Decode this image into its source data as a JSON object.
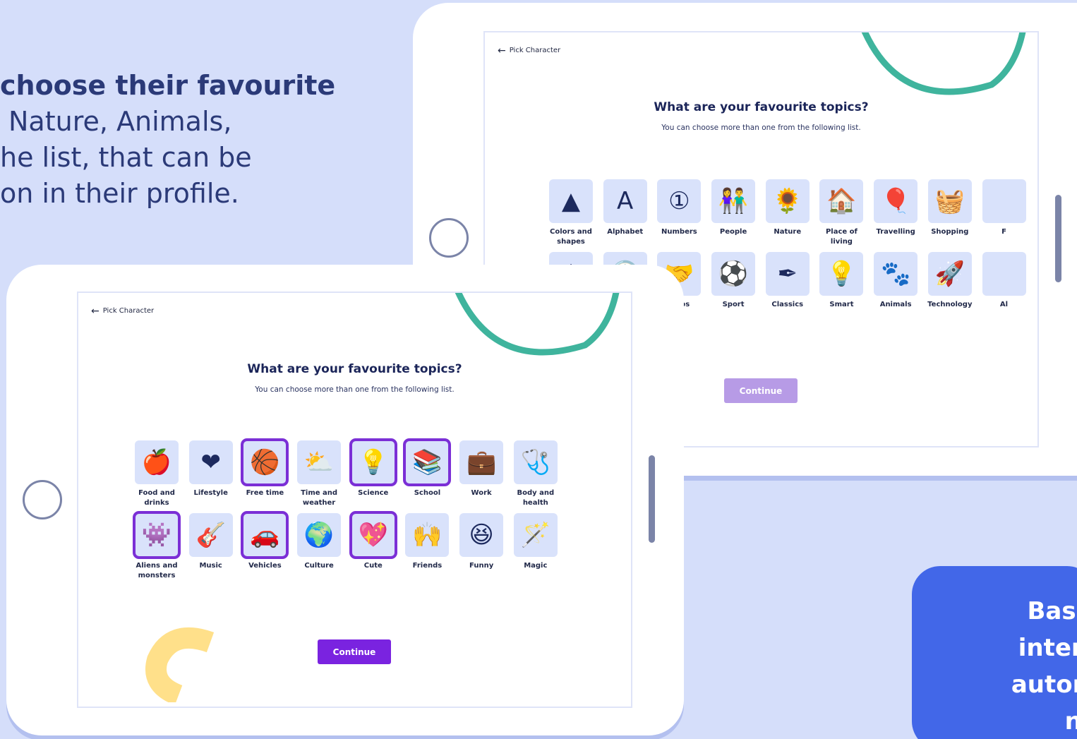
{
  "intro": {
    "line1": "choose their favourite",
    "line2": "Nature, Animals,",
    "line3": "he list, that can be",
    "line4": "on in their profile."
  },
  "banner": {
    "line1": "Based",
    "line2": "interes",
    "line3": "automa",
    "line4": "nev"
  },
  "colors": {
    "accent": "#7a23e0",
    "tile_bg": "#d9e2fb",
    "arc_green": "#3fb49d",
    "arc_yellow": "#ffe08a",
    "banner": "#4267e8"
  },
  "back_screen": {
    "back_label": "Pick Character",
    "title": "What are your favourite topics?",
    "subtitle": "You can choose more than one from the following list.",
    "continue": "Continue",
    "row1": [
      {
        "label": "Colors and shapes",
        "icon": "shapes-icon",
        "glyph": "▲"
      },
      {
        "label": "Alphabet",
        "icon": "alphabet-blocks-icon",
        "glyph": "A"
      },
      {
        "label": "Numbers",
        "icon": "numbers-icon",
        "glyph": "①"
      },
      {
        "label": "People",
        "icon": "people-icon",
        "glyph": "👫"
      },
      {
        "label": "Nature",
        "icon": "flower-icon",
        "glyph": "🌻"
      },
      {
        "label": "Place of living",
        "icon": "house-icon",
        "glyph": "🏠"
      },
      {
        "label": "Travelling",
        "icon": "balloon-icon",
        "glyph": "🎈"
      },
      {
        "label": "Shopping",
        "icon": "basket-icon",
        "glyph": "🧺"
      },
      {
        "label": "F",
        "icon": "partial-icon",
        "glyph": ""
      }
    ],
    "row2": [
      {
        "label": "",
        "icon": "weather-partial-icon",
        "glyph": "☀"
      },
      {
        "label": "",
        "icon": "clock-partial-icon",
        "glyph": "🕒"
      },
      {
        "label": "ships",
        "icon": "handshake-icon",
        "glyph": "🤝"
      },
      {
        "label": "Sport",
        "icon": "sport-balls-icon",
        "glyph": "⚽"
      },
      {
        "label": "Classics",
        "icon": "quill-icon",
        "glyph": "✒"
      },
      {
        "label": "Smart",
        "icon": "lightbulb-icon",
        "glyph": "💡"
      },
      {
        "label": "Animals",
        "icon": "pawprint-icon",
        "glyph": "🐾"
      },
      {
        "label": "Technology",
        "icon": "rocket-icon",
        "glyph": "🚀"
      },
      {
        "label": "Al",
        "icon": "partial-icon",
        "glyph": ""
      }
    ]
  },
  "front_screen": {
    "back_label": "Pick Character",
    "title": "What are your favourite topics?",
    "subtitle": "You can choose more than one from the following list.",
    "continue": "Continue",
    "row1": [
      {
        "label": "Food and drinks",
        "icon": "food-drinks-icon",
        "glyph": "🍎",
        "selected": false
      },
      {
        "label": "Lifestyle",
        "icon": "heart-icon",
        "glyph": "❤",
        "selected": false
      },
      {
        "label": "Free time",
        "icon": "basketball-icon",
        "glyph": "🏀",
        "selected": true
      },
      {
        "label": "Time and weather",
        "icon": "cloud-clock-icon",
        "glyph": "⛅",
        "selected": false
      },
      {
        "label": "Science",
        "icon": "lightbulb-icon",
        "glyph": "💡",
        "selected": true
      },
      {
        "label": "School",
        "icon": "books-apple-icon",
        "glyph": "📚",
        "selected": true
      },
      {
        "label": "Work",
        "icon": "briefcase-icon",
        "glyph": "💼",
        "selected": false
      },
      {
        "label": "Body and health",
        "icon": "first-aid-icon",
        "glyph": "🩺",
        "selected": false
      }
    ],
    "row2": [
      {
        "label": "Aliens and monsters",
        "icon": "monster-icon",
        "glyph": "👾",
        "selected": true
      },
      {
        "label": "Music",
        "icon": "guitar-icon",
        "glyph": "🎸",
        "selected": false
      },
      {
        "label": "Vehicles",
        "icon": "car-icon",
        "glyph": "🚗",
        "selected": true
      },
      {
        "label": "Culture",
        "icon": "globe-plane-icon",
        "glyph": "🌍",
        "selected": false
      },
      {
        "label": "Cute",
        "icon": "heart-face-icon",
        "glyph": "💖",
        "selected": true
      },
      {
        "label": "Friends",
        "icon": "friends-icon",
        "glyph": "🙌",
        "selected": false
      },
      {
        "label": "Funny",
        "icon": "laughing-face-icon",
        "glyph": "😆",
        "selected": false
      },
      {
        "label": "Magic",
        "icon": "magic-wand-icon",
        "glyph": "🪄",
        "selected": false
      }
    ]
  }
}
